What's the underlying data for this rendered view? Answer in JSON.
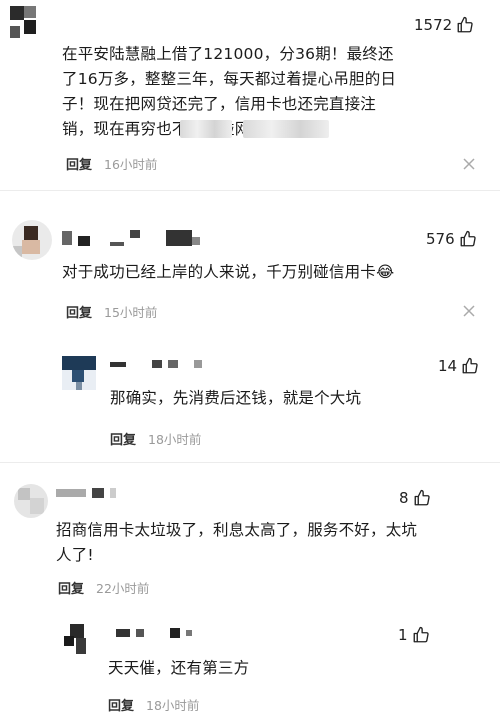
{
  "comments": [
    {
      "likes": "1572",
      "text": "在平安陆慧融上借了121000，分36期！最终还了16万多，整整三年，每天都过着提心吊胆的日子！现在把网贷还完了，信用卡也还完直接注销，现在再穷也不要去碰网贷，",
      "reply_label": "回复",
      "time": "16小时前"
    },
    {
      "likes": "576",
      "text": "对于成功已经上岸的人来说，千万别碰信用卡",
      "emoji": "😂",
      "reply_label": "回复",
      "time": "15小时前",
      "replies": [
        {
          "likes": "14",
          "text": "那确实，先消费后还钱，就是个大坑",
          "reply_label": "回复",
          "time": "18小时前"
        }
      ]
    },
    {
      "likes": "8",
      "text": "招商信用卡太垃圾了，利息太高了，服务不好，太坑人了!",
      "reply_label": "回复",
      "time": "22小时前",
      "replies": [
        {
          "likes": "1",
          "text": "天天催，还有第三方",
          "reply_label": "回复",
          "time": "18小时前"
        }
      ]
    }
  ]
}
